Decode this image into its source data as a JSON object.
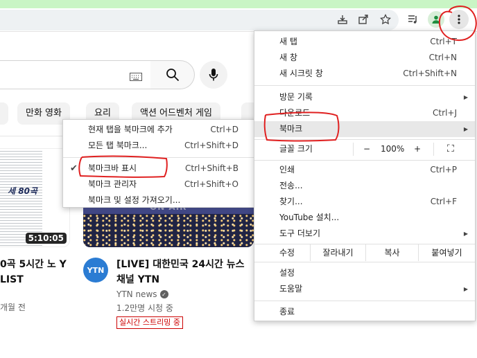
{
  "toolbar": {
    "icons": [
      "download-icon",
      "share-icon",
      "bookmark-star-icon",
      "media-queue-icon",
      "profile-icon",
      "kebab-menu-icon"
    ]
  },
  "youtube": {
    "chips": [
      "만화 영화",
      "요리",
      "액션 어드벤처 게임"
    ],
    "video1": {
      "thumb_badge": "세 80곡",
      "duration": "5:10:05",
      "title": "0곡 5시간 노 Y LIST",
      "meta": "개월 전"
    },
    "video2": {
      "thumb_text": "ON AIR",
      "avatar": "YTN",
      "title": "[LIVE] 대한민국 24시간 뉴스 채널 YTN",
      "channel": "YTN news",
      "views": "1.2만명 시청 중",
      "live_badge": "실시간 스트리밍 중"
    }
  },
  "bookmark_submenu": {
    "items": [
      {
        "label": "현재 탭을 북마크에 추가",
        "shortcut": "Ctrl+D"
      },
      {
        "label": "모든 탭 북마크...",
        "shortcut": "Ctrl+Shift+D"
      },
      {
        "label": "북마크바 표시",
        "shortcut": "Ctrl+Shift+B",
        "checked": true
      },
      {
        "label": "북마크 관리자",
        "shortcut": "Ctrl+Shift+O"
      },
      {
        "label": "북마크 및 설정 가져오기...",
        "shortcut": ""
      }
    ]
  },
  "chrome_menu": {
    "new_tab": {
      "label": "새 탭",
      "shortcut": "Ctrl+T"
    },
    "new_window": {
      "label": "새 창",
      "shortcut": "Ctrl+N"
    },
    "incognito": {
      "label": "새 시크릿 창",
      "shortcut": "Ctrl+Shift+N"
    },
    "history": {
      "label": "방문 기록"
    },
    "downloads": {
      "label": "다운로드",
      "shortcut": "Ctrl+J"
    },
    "bookmarks": {
      "label": "북마크"
    },
    "zoom": {
      "label": "글꼴 크기",
      "minus": "−",
      "value": "100%",
      "plus": "+",
      "fullscreen": "⛶"
    },
    "print": {
      "label": "인쇄",
      "shortcut": "Ctrl+P"
    },
    "cast": {
      "label": "전송..."
    },
    "find": {
      "label": "찾기...",
      "shortcut": "Ctrl+F"
    },
    "install": {
      "label": "YouTube 설치..."
    },
    "more_tools": {
      "label": "도구 더보기"
    },
    "edit": {
      "label": "수정",
      "cut": "잘라내기",
      "copy": "복사",
      "paste": "붙여넣기"
    },
    "settings": {
      "label": "설정"
    },
    "help": {
      "label": "도움말"
    },
    "exit": {
      "label": "종료"
    }
  },
  "colors": {
    "annotation_red": "#e02020",
    "top_strip_green": "#c9f5c5"
  }
}
